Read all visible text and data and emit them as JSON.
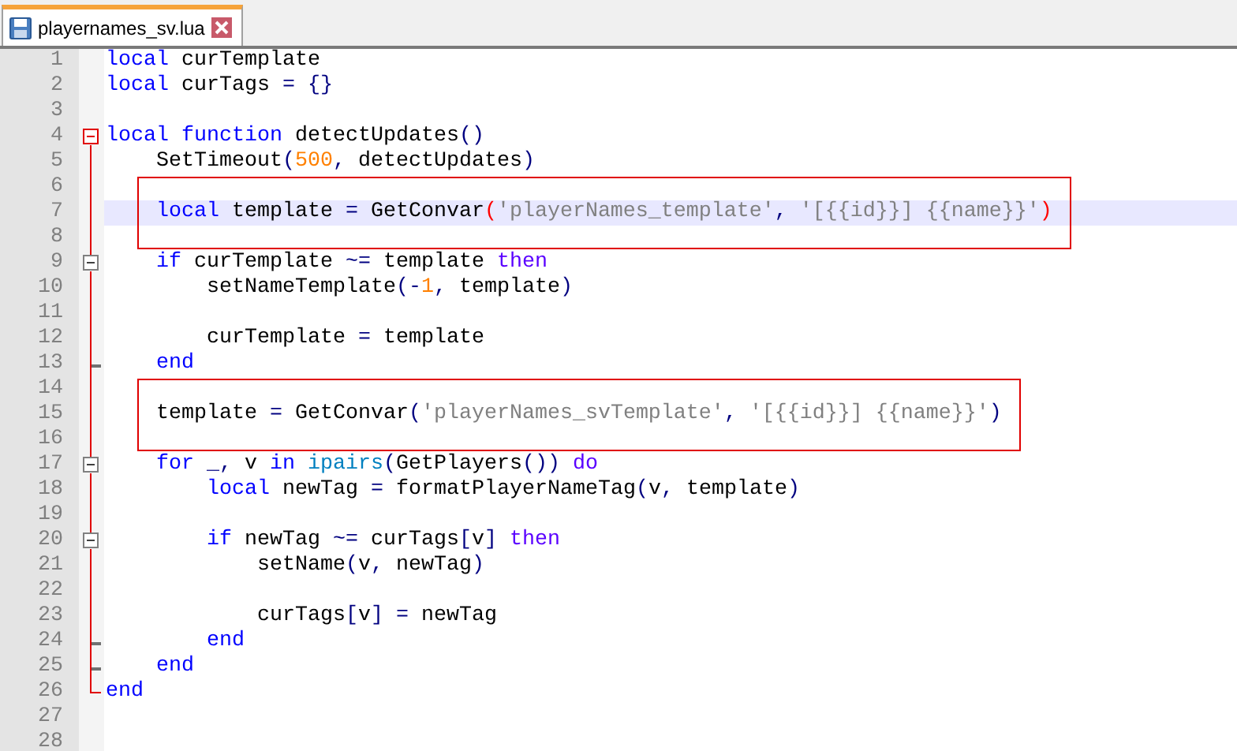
{
  "tabs": [
    {
      "label": "playernames_sv.lua",
      "selected": true
    }
  ],
  "lines": [
    {
      "number": "1",
      "tokens": [
        {
          "t": "local ",
          "color": "#0000ff"
        },
        {
          "t": "curTemplate",
          "color": "#000000"
        }
      ]
    },
    {
      "number": "2",
      "tokens": [
        {
          "t": "local ",
          "color": "#0000ff"
        },
        {
          "t": "curTags ",
          "color": "#000000"
        },
        {
          "t": "= {}",
          "color": "#000080"
        }
      ]
    },
    {
      "number": "3"
    },
    {
      "number": "4",
      "fold_start": true,
      "active": true,
      "tokens": [
        {
          "t": "local function ",
          "color": "#0000ff"
        },
        {
          "t": "detectUpdates",
          "color": "#000000"
        },
        {
          "t": "()",
          "color": "#000080"
        }
      ]
    },
    {
      "number": "5",
      "tokens": [
        {
          "t": "    SetTimeout",
          "color": "#000000"
        },
        {
          "t": "(",
          "color": "#000080"
        },
        {
          "t": "500",
          "color": "#ff8000"
        },
        {
          "t": ",",
          "color": "#000080"
        },
        {
          "t": " detectUpdates",
          "color": "#000000"
        },
        {
          "t": ")",
          "color": "#000080"
        }
      ]
    },
    {
      "number": "6",
      "boxed": true
    },
    {
      "number": "7",
      "boxed": true,
      "current": true,
      "tokens": [
        {
          "t": "    local",
          "color": "#0000ff"
        },
        {
          "t": " template ",
          "color": "#000000"
        },
        {
          "t": "=",
          "color": "#000080"
        },
        {
          "t": " GetConvar",
          "color": "#000000"
        },
        {
          "t": "(",
          "color": "#ff0000"
        },
        {
          "t": "'playerNames_template'",
          "color": "#808080"
        },
        {
          "t": ", ",
          "color": "#000080"
        },
        {
          "t": "'[{{id}}] {{name}}'",
          "color": "#808080"
        },
        {
          "t": ")",
          "color": "#ff0000"
        }
      ]
    },
    {
      "number": "8",
      "boxed": true
    },
    {
      "number": "9",
      "fold_start": true,
      "active": false,
      "tokens": [
        {
          "t": "    if",
          "color": "#0000ff"
        },
        {
          "t": " curTemplate ",
          "color": "#000000"
        },
        {
          "t": "~=",
          "color": "#000080"
        },
        {
          "t": " template ",
          "color": "#000000"
        },
        {
          "t": "then",
          "color": "#5a00ff"
        }
      ]
    },
    {
      "number": "10",
      "tokens": [
        {
          "t": "        setNameTemplate",
          "color": "#000000"
        },
        {
          "t": "(-",
          "color": "#000080"
        },
        {
          "t": "1",
          "color": "#ff8000"
        },
        {
          "t": ",",
          "color": "#000080"
        },
        {
          "t": " template",
          "color": "#000000"
        },
        {
          "t": ")",
          "color": "#000080"
        }
      ]
    },
    {
      "number": "11"
    },
    {
      "number": "12",
      "tokens": [
        {
          "t": "        curTemplate ",
          "color": "#000000"
        },
        {
          "t": "=",
          "color": "#000080"
        },
        {
          "t": " template",
          "color": "#000000"
        }
      ]
    },
    {
      "number": "13",
      "fold_end": true,
      "tokens": [
        {
          "t": "    end",
          "color": "#0000ff"
        }
      ]
    },
    {
      "number": "14",
      "boxed": true
    },
    {
      "number": "15",
      "boxed": true,
      "tokens": [
        {
          "t": "    template ",
          "color": "#000000"
        },
        {
          "t": "=",
          "color": "#000080"
        },
        {
          "t": " GetConvar",
          "color": "#000000"
        },
        {
          "t": "(",
          "color": "#000080"
        },
        {
          "t": "'playerNames_svTemplate'",
          "color": "#808080"
        },
        {
          "t": ", ",
          "color": "#000080"
        },
        {
          "t": "'[{{id}}] {{name}}'",
          "color": "#808080"
        },
        {
          "t": ")",
          "color": "#000080"
        }
      ]
    },
    {
      "number": "16",
      "boxed": true
    },
    {
      "number": "17",
      "fold_start": true,
      "active": false,
      "tokens": [
        {
          "t": "    for",
          "color": "#0000ff"
        },
        {
          "t": " _,",
          "color": "#000080"
        },
        {
          "t": " v ",
          "color": "#000000"
        },
        {
          "t": "in ",
          "color": "#0000ff"
        },
        {
          "t": "ipairs",
          "color": "#0080c0"
        },
        {
          "t": "(",
          "color": "#000080"
        },
        {
          "t": "GetPlayers",
          "color": "#000000"
        },
        {
          "t": "()) ",
          "color": "#000080"
        },
        {
          "t": "do",
          "color": "#5a00ff"
        }
      ]
    },
    {
      "number": "18",
      "tokens": [
        {
          "t": "        local",
          "color": "#0000ff"
        },
        {
          "t": " newTag ",
          "color": "#000000"
        },
        {
          "t": "=",
          "color": "#000080"
        },
        {
          "t": " formatPlayerNameTag",
          "color": "#000000"
        },
        {
          "t": "(",
          "color": "#000080"
        },
        {
          "t": "v",
          "color": "#000000"
        },
        {
          "t": ",",
          "color": "#000080"
        },
        {
          "t": " template",
          "color": "#000000"
        },
        {
          "t": ")",
          "color": "#000080"
        }
      ]
    },
    {
      "number": "19"
    },
    {
      "number": "20",
      "fold_start": true,
      "active": false,
      "tokens": [
        {
          "t": "        if",
          "color": "#0000ff"
        },
        {
          "t": " newTag ",
          "color": "#000000"
        },
        {
          "t": "~=",
          "color": "#000080"
        },
        {
          "t": " curTags",
          "color": "#000000"
        },
        {
          "t": "[",
          "color": "#000080"
        },
        {
          "t": "v",
          "color": "#000000"
        },
        {
          "t": "] ",
          "color": "#000080"
        },
        {
          "t": "then",
          "color": "#5a00ff"
        }
      ]
    },
    {
      "number": "21",
      "tokens": [
        {
          "t": "            setName",
          "color": "#000000"
        },
        {
          "t": "(",
          "color": "#000080"
        },
        {
          "t": "v",
          "color": "#000000"
        },
        {
          "t": ",",
          "color": "#000080"
        },
        {
          "t": " newTag",
          "color": "#000000"
        },
        {
          "t": ")",
          "color": "#000080"
        }
      ]
    },
    {
      "number": "22"
    },
    {
      "number": "23",
      "tokens": [
        {
          "t": "            curTags",
          "color": "#000000"
        },
        {
          "t": "[",
          "color": "#000080"
        },
        {
          "t": "v",
          "color": "#000000"
        },
        {
          "t": "] =",
          "color": "#000080"
        },
        {
          "t": " newTag",
          "color": "#000000"
        }
      ]
    },
    {
      "number": "24",
      "fold_end": true,
      "tokens": [
        {
          "t": "        end",
          "color": "#0000ff"
        }
      ]
    },
    {
      "number": "25",
      "fold_end": true,
      "tokens": [
        {
          "t": "    end",
          "color": "#0000ff"
        }
      ]
    },
    {
      "number": "26",
      "fold_end": true,
      "tokens": [
        {
          "t": "end",
          "color": "#0000ff"
        }
      ]
    },
    {
      "number": "27"
    },
    {
      "number": "28"
    }
  ]
}
